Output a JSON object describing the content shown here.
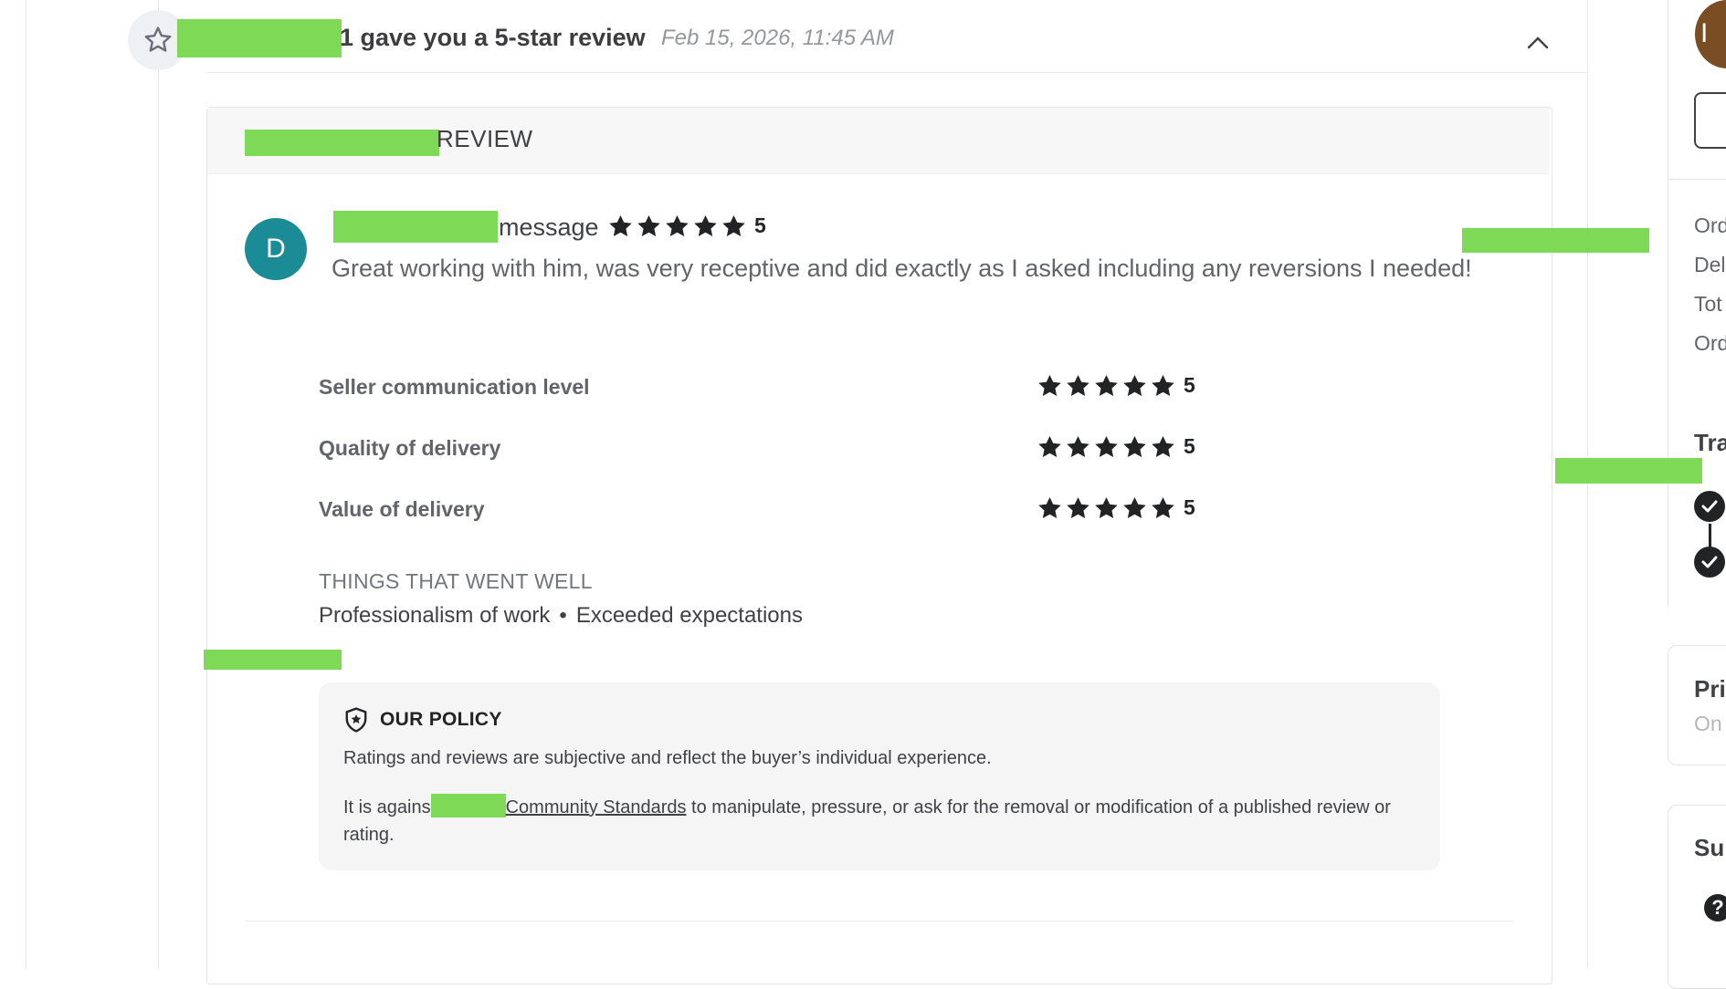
{
  "header": {
    "title_suffix": "1 gave you a 5-star review",
    "date": "Feb 15, 2026, 11:45 AM",
    "icon": "star-outline-icon",
    "collapse_icon": "chevron-up-icon"
  },
  "card": {
    "title_suffix": "REVIEW"
  },
  "review": {
    "avatar_letter": "D",
    "name_suffix": "message",
    "rating": "5",
    "text": "Great working with him, was very receptive and did exactly as I asked including any reversions I needed!"
  },
  "ratings": [
    {
      "label": "Seller communication level",
      "value": "5"
    },
    {
      "label": "Quality of delivery",
      "value": "5"
    },
    {
      "label": "Value of delivery",
      "value": "5"
    }
  ],
  "went_well": {
    "title": "THINGS THAT WENT WELL",
    "items": [
      "Professionalism of work",
      "Exceeded expectations"
    ],
    "separator": "•"
  },
  "policy": {
    "title": "OUR POLICY",
    "p1": "Ratings and reviews are subjective and reflect the buyer’s individual experience.",
    "p2_prefix": "It is agains",
    "p2_link": "Community Standards",
    "p2_suffix": " to manipulate, pressure, or ask for the removal or modification of a published review or rating."
  },
  "sidebar": {
    "avatar_letter": "I",
    "rows": [
      "Ord",
      "Del",
      "Tot",
      "Ord"
    ],
    "track_heading": "Tra",
    "privacy_heading": "Pri",
    "privacy_sub": "On",
    "support_heading": "Sup",
    "help_icon": "?"
  },
  "colors": {
    "avatar_teal": "#1b8b96",
    "side_avatar_brown": "#7b4d23",
    "redaction_green": "#7ed957"
  }
}
